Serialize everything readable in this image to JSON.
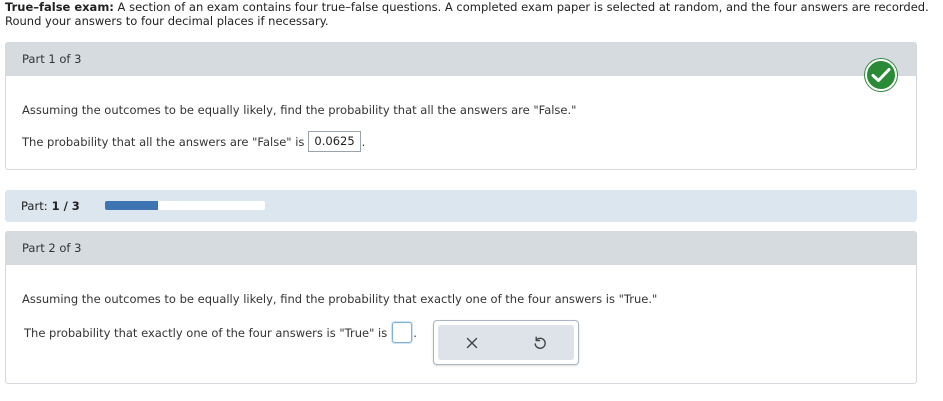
{
  "problem": {
    "title": "True–false exam:",
    "text": " A section of an exam contains four true–false questions. A completed exam paper is selected at random, and the four answers are recorded. Round your answers to four decimal places if necessary."
  },
  "part1": {
    "header": "Part 1 of 3",
    "question": "Assuming the outcomes to be equally likely, find the probability that all the answers are \"False.\"",
    "answer_prefix": "The probability that all the answers are \"False\" is",
    "answer_value": "0.0625",
    "answer_suffix": ".",
    "status_icon": "checkmark-icon",
    "status_color": "#2a8a36"
  },
  "progress": {
    "label": "Part:",
    "value_text": "1 / 3",
    "fraction": 0.333,
    "fill_color": "#3f74b2"
  },
  "part2": {
    "header": "Part 2 of 3",
    "question": "Assuming the outcomes to be equally likely, find the probability that exactly one of the four answers is \"True.\"",
    "answer_prefix": "The probability that exactly one of the four answers is \"True\" is",
    "answer_value": "",
    "answer_suffix": ".",
    "tools": [
      {
        "icon": "clear-x-icon",
        "glyph": "×"
      },
      {
        "icon": "undo-icon",
        "glyph": "↺"
      }
    ]
  }
}
